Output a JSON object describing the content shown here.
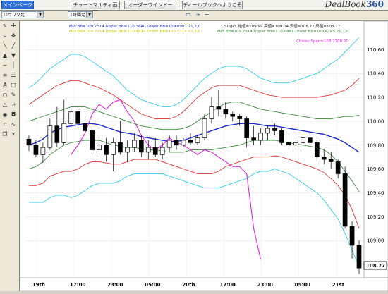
{
  "tabs": [
    {
      "label": "メインページ",
      "active": true
    },
    {
      "label": "チャートマルティ画面",
      "active": false
    },
    {
      "label": "オーダーウインドー",
      "active": false
    },
    {
      "label": "ディールブックへようこそ",
      "active": false
    }
  ],
  "logo": {
    "text": "DealBook",
    "number": "360"
  },
  "toolbar": {
    "symbol_select": "ロウソク足",
    "timeframe_select": "1時間足",
    "icons": [
      "window-icon",
      "zoom-in-icon",
      "zoom-out-icon"
    ]
  },
  "chart_header": {
    "left_ind": "Mid BB=109.7314 Upper BB=110.3640 Lower BB=109.0981 21,2,0",
    "left_ind2": "Mid BB=109.7314 Upper BB=110.4814 Lower BB=108.7314 21,3,0",
    "right_ind": "Mid BB=109.7314 Upper BB=110.0481 Lower BB=109.4145 21,1,0",
    "chikou": "Chikou Span=108.7700 20",
    "ohlc": "USD/JPY 始値=109.99 高値=109.04 安値=108.72 終値=108.77"
  },
  "price_axis": {
    "labels": [
      "110.60",
      "110.40",
      "110.20",
      "110.00",
      "109.80",
      "109.60",
      "109.40",
      "109.20",
      "109.00"
    ],
    "current": "108.77"
  },
  "time_axis": {
    "labels": [
      "19th",
      "17:00",
      "23:00",
      "05:00",
      "20th",
      "17:00",
      "23:00",
      "05:00",
      "21st"
    ]
  },
  "chart_data": {
    "type": "candlestick",
    "ylim": [
      108.7,
      110.72
    ],
    "candles": [
      [
        109.85,
        109.88,
        109.75,
        109.8
      ],
      [
        109.8,
        109.84,
        109.7,
        109.72
      ],
      [
        109.72,
        109.82,
        109.65,
        109.78
      ],
      [
        109.78,
        110.02,
        109.76,
        109.96
      ],
      [
        109.96,
        110.12,
        109.78,
        109.82
      ],
      [
        109.82,
        110.18,
        109.8,
        109.98
      ],
      [
        109.98,
        110.12,
        109.94,
        110.08
      ],
      [
        110.08,
        110.1,
        109.94,
        109.98
      ],
      [
        109.98,
        110.04,
        109.88,
        109.92
      ],
      [
        109.92,
        109.96,
        109.72,
        109.76
      ],
      [
        109.76,
        109.84,
        109.7,
        109.8
      ],
      [
        109.8,
        109.86,
        109.66,
        109.72
      ],
      [
        109.72,
        109.86,
        109.58,
        109.82
      ],
      [
        109.82,
        110.0,
        109.72,
        109.74
      ],
      [
        109.74,
        109.84,
        109.66,
        109.78
      ],
      [
        109.78,
        109.9,
        109.74,
        109.84
      ],
      [
        109.84,
        109.88,
        109.7,
        109.74
      ],
      [
        109.74,
        109.84,
        109.68,
        109.78
      ],
      [
        109.78,
        109.86,
        109.7,
        109.72
      ],
      [
        109.72,
        109.82,
        109.68,
        109.78
      ],
      [
        109.78,
        109.88,
        109.74,
        109.84
      ],
      [
        109.84,
        109.88,
        109.76,
        109.8
      ],
      [
        109.8,
        109.86,
        109.78,
        109.84
      ],
      [
        109.84,
        109.9,
        109.8,
        109.82
      ],
      [
        109.82,
        109.88,
        109.8,
        109.86
      ],
      [
        109.86,
        110.06,
        109.84,
        110.02
      ],
      [
        110.02,
        110.2,
        109.98,
        110.12
      ],
      [
        110.12,
        110.26,
        110.04,
        110.1
      ],
      [
        110.1,
        110.16,
        110.02,
        110.06
      ],
      [
        110.06,
        110.08,
        110.0,
        110.04
      ],
      [
        110.04,
        110.06,
        109.96,
        110.02
      ],
      [
        110.02,
        110.04,
        109.78,
        109.86
      ],
      [
        109.86,
        109.96,
        109.8,
        109.84
      ],
      [
        109.84,
        109.94,
        109.8,
        109.9
      ],
      [
        109.9,
        109.96,
        109.84,
        109.94
      ],
      [
        109.94,
        109.98,
        109.88,
        109.92
      ],
      [
        109.92,
        109.94,
        109.8,
        109.82
      ],
      [
        109.82,
        109.9,
        109.76,
        109.8
      ],
      [
        109.8,
        109.84,
        109.76,
        109.82
      ],
      [
        109.82,
        109.88,
        109.78,
        109.86
      ],
      [
        109.86,
        109.9,
        109.8,
        109.82
      ],
      [
        109.82,
        109.84,
        109.66,
        109.7
      ],
      [
        109.7,
        109.76,
        109.64,
        109.68
      ],
      [
        109.68,
        109.74,
        109.6,
        109.66
      ],
      [
        109.66,
        109.68,
        109.52,
        109.56
      ],
      [
        109.56,
        109.62,
        109.1,
        109.12
      ],
      [
        109.12,
        109.16,
        108.85,
        108.96
      ],
      [
        108.96,
        109.0,
        108.72,
        108.77
      ]
    ],
    "mid_bb": [
      109.8,
      109.82,
      109.85,
      109.9,
      109.93,
      109.95,
      109.96,
      109.97,
      109.98,
      109.98,
      109.97,
      109.95,
      109.93,
      109.91,
      109.9,
      109.89,
      109.87,
      109.86,
      109.85,
      109.84,
      109.83,
      109.83,
      109.84,
      109.86,
      109.88,
      109.9,
      109.92,
      109.94,
      109.96,
      109.97,
      109.98,
      109.98,
      109.98,
      109.97,
      109.96,
      109.96,
      109.95,
      109.94,
      109.93,
      109.92,
      109.91,
      109.9,
      109.89,
      109.87,
      109.85,
      109.82,
      109.78,
      109.74
    ],
    "upper1": [
      110.0,
      110.02,
      110.04,
      110.06,
      110.08,
      110.1,
      110.12,
      110.12,
      110.12,
      110.1,
      110.08,
      110.06,
      110.04,
      110.02,
      110.0,
      109.98,
      109.96,
      109.95,
      109.94,
      109.93,
      109.93,
      109.93,
      109.94,
      109.96,
      110.0,
      110.04,
      110.08,
      110.12,
      110.15,
      110.16,
      110.16,
      110.14,
      110.12,
      110.1,
      110.09,
      110.08,
      110.07,
      110.06,
      110.05,
      110.04,
      110.03,
      110.02,
      110.02,
      110.02,
      110.03,
      110.04,
      110.04,
      110.05
    ],
    "lower1": [
      109.6,
      109.62,
      109.66,
      109.72,
      109.76,
      109.8,
      109.82,
      109.83,
      109.84,
      109.84,
      109.84,
      109.82,
      109.8,
      109.79,
      109.78,
      109.78,
      109.77,
      109.76,
      109.76,
      109.75,
      109.74,
      109.74,
      109.74,
      109.76,
      109.76,
      109.76,
      109.76,
      109.77,
      109.78,
      109.79,
      109.8,
      109.82,
      109.84,
      109.84,
      109.84,
      109.84,
      109.83,
      109.82,
      109.81,
      109.8,
      109.79,
      109.78,
      109.76,
      109.72,
      109.66,
      109.58,
      109.5,
      109.41
    ],
    "upper2": [
      110.14,
      110.18,
      110.22,
      110.26,
      110.3,
      110.32,
      110.34,
      110.34,
      110.32,
      110.3,
      110.28,
      110.25,
      110.22,
      110.18,
      110.14,
      110.1,
      110.06,
      110.04,
      110.02,
      110.02,
      110.02,
      110.04,
      110.08,
      110.14,
      110.2,
      110.24,
      110.28,
      110.3,
      110.3,
      110.3,
      110.3,
      110.28,
      110.26,
      110.24,
      110.22,
      110.21,
      110.2,
      110.2,
      110.2,
      110.2,
      110.2,
      110.2,
      110.21,
      110.22,
      110.24,
      110.26,
      110.3,
      110.36
    ],
    "lower2": [
      109.46,
      109.46,
      109.48,
      109.54,
      109.56,
      109.58,
      109.58,
      109.6,
      109.64,
      109.66,
      109.66,
      109.65,
      109.64,
      109.64,
      109.66,
      109.68,
      109.68,
      109.68,
      109.68,
      109.66,
      109.64,
      109.62,
      109.6,
      109.58,
      109.56,
      109.56,
      109.56,
      109.58,
      109.62,
      109.64,
      109.66,
      109.68,
      109.7,
      109.7,
      109.7,
      109.71,
      109.7,
      109.68,
      109.66,
      109.64,
      109.62,
      109.6,
      109.57,
      109.52,
      109.46,
      109.38,
      109.26,
      109.1
    ],
    "upper3": [
      110.28,
      110.32,
      110.38,
      110.44,
      110.48,
      110.52,
      110.56,
      110.56,
      110.54,
      110.5,
      110.46,
      110.42,
      110.38,
      110.32,
      110.26,
      110.22,
      110.18,
      110.16,
      110.14,
      110.12,
      110.12,
      110.14,
      110.18,
      110.24,
      110.3,
      110.36,
      110.4,
      110.44,
      110.46,
      110.46,
      110.46,
      110.44,
      110.4,
      110.36,
      110.34,
      110.32,
      110.32,
      110.32,
      110.34,
      110.36,
      110.38,
      110.4,
      110.44,
      110.48,
      110.52,
      110.58,
      110.64,
      110.7
    ],
    "lower3": [
      109.32,
      109.32,
      109.32,
      109.36,
      109.38,
      109.38,
      109.36,
      109.38,
      109.42,
      109.46,
      109.48,
      109.48,
      109.48,
      109.5,
      109.54,
      109.56,
      109.56,
      109.56,
      109.56,
      109.56,
      109.54,
      109.52,
      109.5,
      109.48,
      109.46,
      109.44,
      109.44,
      109.44,
      109.46,
      109.48,
      109.5,
      109.52,
      109.56,
      109.58,
      109.58,
      109.6,
      109.58,
      109.56,
      109.52,
      109.48,
      109.44,
      109.4,
      109.34,
      109.26,
      109.18,
      109.06,
      108.92,
      108.78
    ],
    "chikou": [
      109.72,
      109.8,
      109.9,
      110.06,
      110.14,
      110.1,
      110.16,
      110.18,
      110.08,
      110.0,
      109.88,
      109.8,
      109.76,
      109.8,
      109.86,
      109.82,
      109.8,
      109.76,
      109.72,
      109.76,
      109.74,
      109.7,
      109.66,
      109.62,
      109.62,
      109.56,
      109.1,
      108.84
    ],
    "colors": {
      "mid": "#1a2acc",
      "bb1": "#3a8a3a",
      "bb2": "#e03030",
      "bb3": "#33ccee",
      "chikou": "#e020e0"
    }
  }
}
